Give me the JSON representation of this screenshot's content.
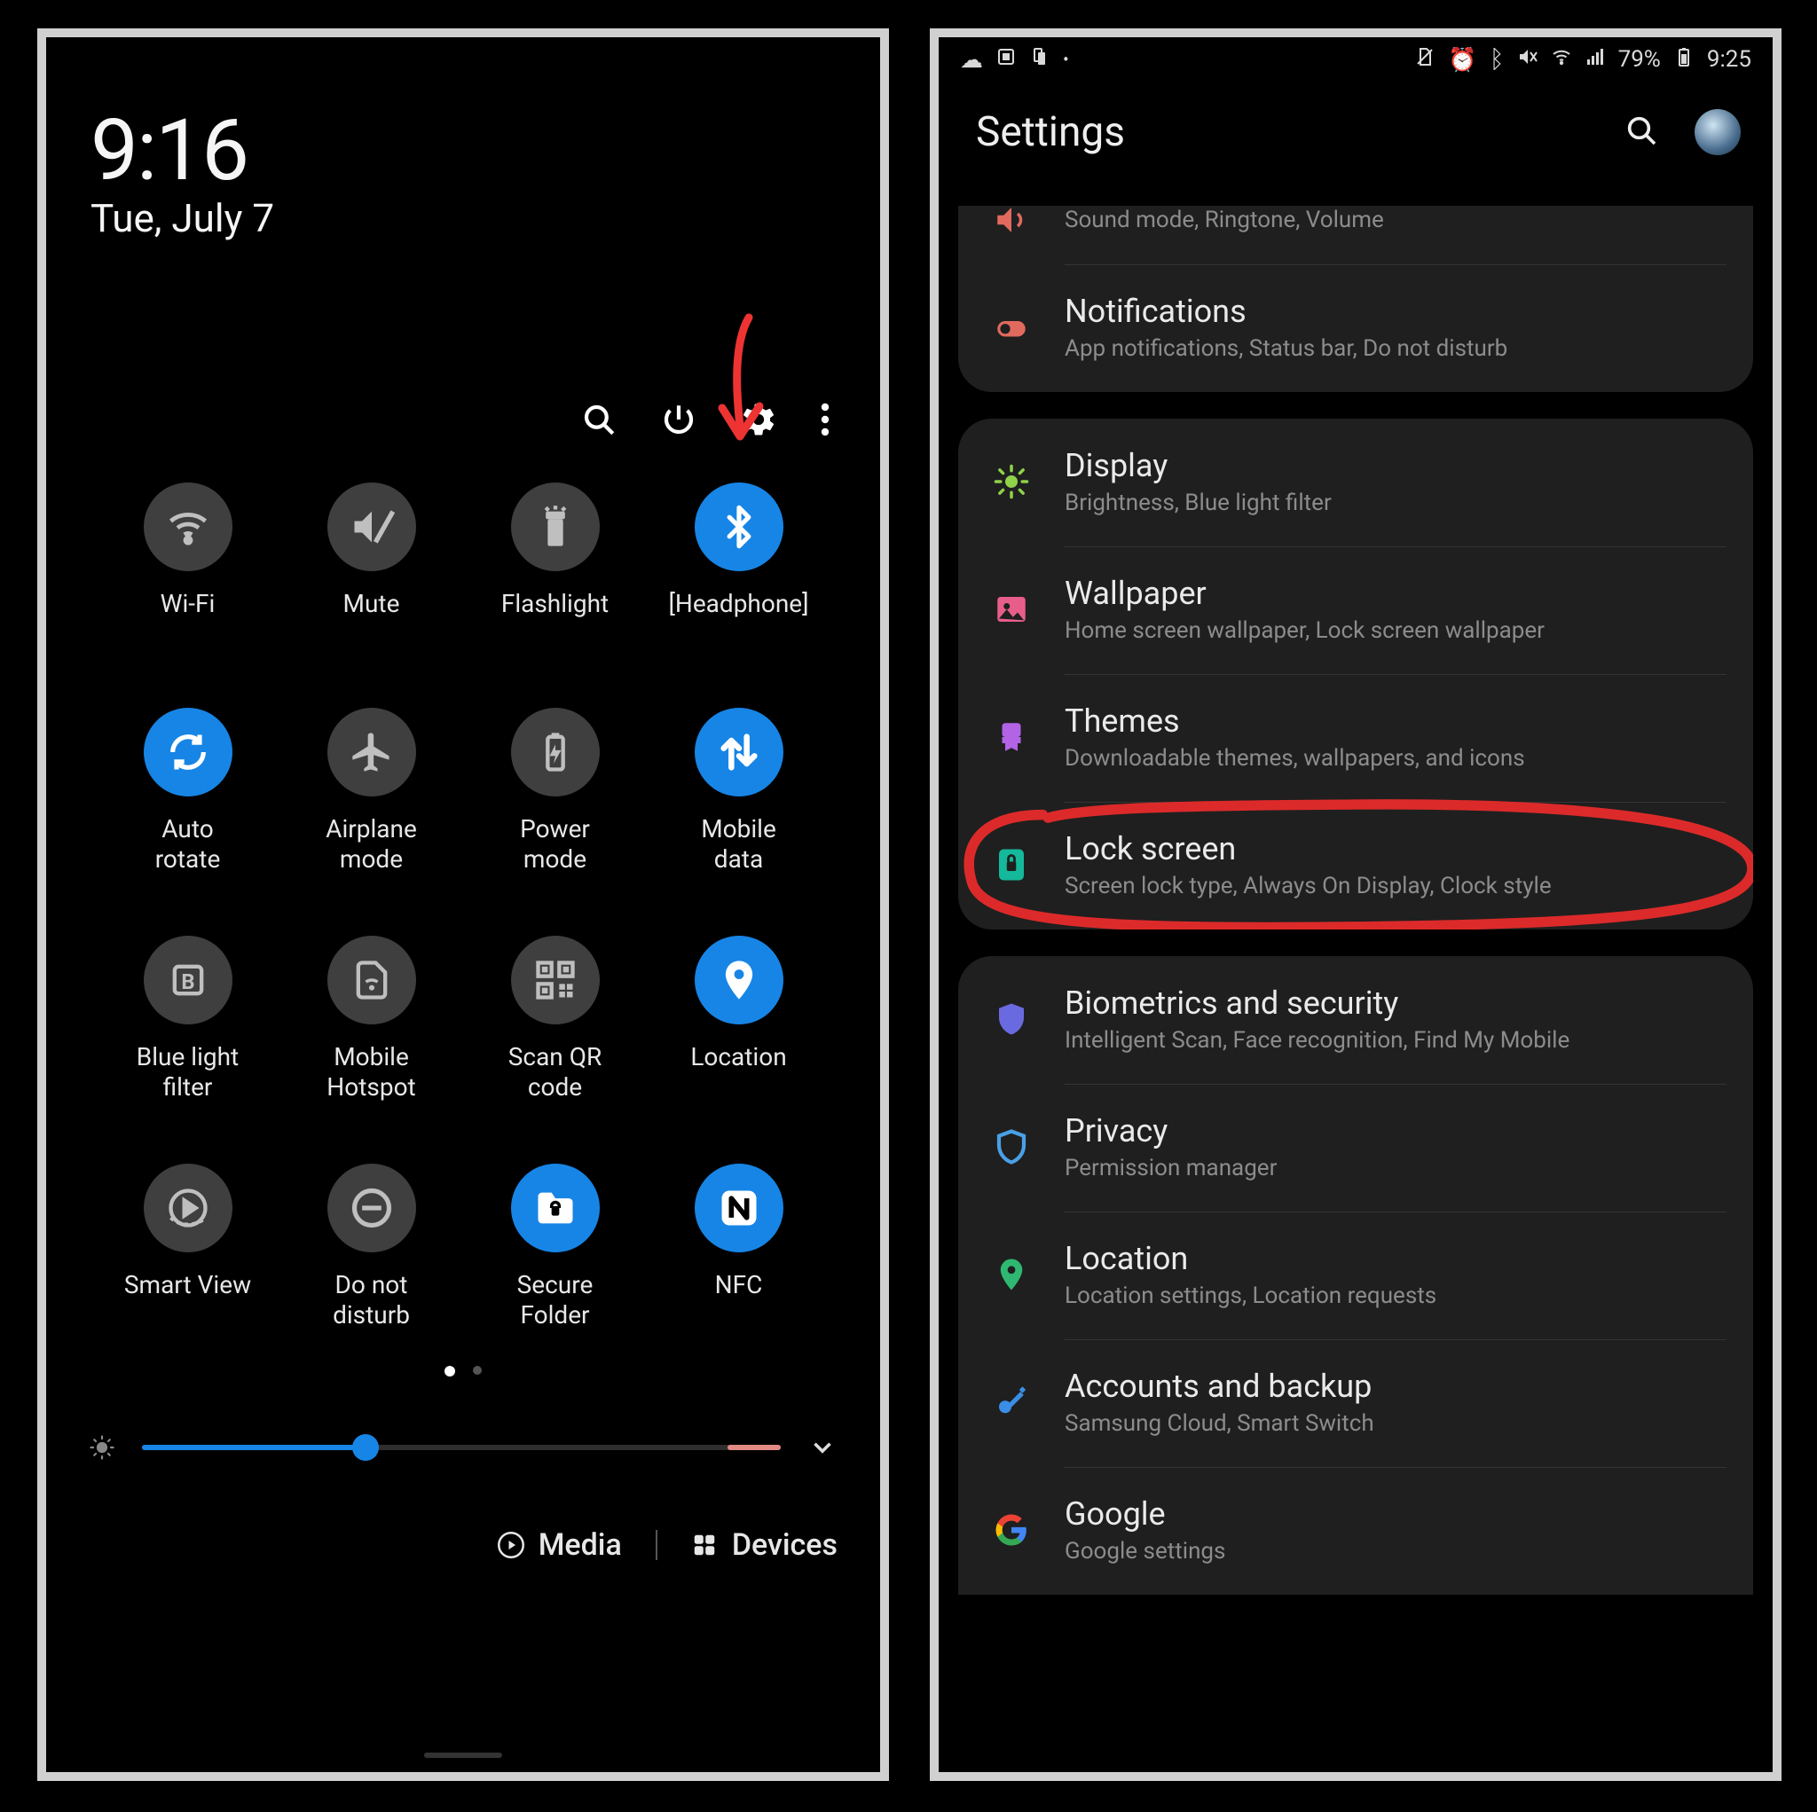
{
  "shot1": {
    "time": "9:16",
    "date": "Tue, July 7",
    "quick_tiles": [
      {
        "icon": "wifi",
        "label": "Wi-Fi",
        "active": false
      },
      {
        "icon": "mute",
        "label": "Mute",
        "active": false
      },
      {
        "icon": "flashlight",
        "label": "Flashlight",
        "active": false
      },
      {
        "icon": "bluetooth",
        "label": "[Headphone]",
        "active": true
      },
      {
        "icon": "rotate",
        "label": "Auto\nrotate",
        "active": true
      },
      {
        "icon": "airplane",
        "label": "Airplane\nmode",
        "active": false
      },
      {
        "icon": "battery",
        "label": "Power\nmode",
        "active": false
      },
      {
        "icon": "data",
        "label": "Mobile\ndata",
        "active": true
      },
      {
        "icon": "bluelight",
        "label": "Blue light\nfilter",
        "active": false
      },
      {
        "icon": "hotspot",
        "label": "Mobile\nHotspot",
        "active": false
      },
      {
        "icon": "qr",
        "label": "Scan QR\ncode",
        "active": false
      },
      {
        "icon": "location",
        "label": "Location",
        "active": true
      },
      {
        "icon": "smartview",
        "label": "Smart View",
        "active": false
      },
      {
        "icon": "dnd",
        "label": "Do not\ndisturb",
        "active": false
      },
      {
        "icon": "folder",
        "label": "Secure\nFolder",
        "active": true
      },
      {
        "icon": "nfc",
        "label": "NFC",
        "active": true
      }
    ],
    "brightness_percent": 35,
    "footer": {
      "media": "Media",
      "devices": "Devices"
    }
  },
  "shot2": {
    "status": {
      "battery": "79%",
      "time": "9:25"
    },
    "title": "Settings",
    "groups": [
      {
        "rows": [
          {
            "ico": "sound",
            "color": "#e06a5e",
            "title": "",
            "sub": "Sound mode, Ringtone, Volume",
            "trunc_top": true
          },
          {
            "ico": "notification",
            "color": "#e06a5e",
            "title": "Notifications",
            "sub": "App notifications, Status bar, Do not disturb"
          }
        ]
      },
      {
        "rows": [
          {
            "ico": "display",
            "color": "#8fd24a",
            "title": "Display",
            "sub": "Brightness, Blue light filter"
          },
          {
            "ico": "wallpaper",
            "color": "#e85e8a",
            "title": "Wallpaper",
            "sub": "Home screen wallpaper, Lock screen wallpaper"
          },
          {
            "ico": "themes",
            "color": "#b263e6",
            "title": "Themes",
            "sub": "Downloadable themes, wallpapers, and icons"
          },
          {
            "ico": "lock",
            "color": "#14b89a",
            "title": "Lock screen",
            "sub": "Screen lock type, Always On Display, Clock style",
            "circled": true
          }
        ]
      },
      {
        "rows": [
          {
            "ico": "shield",
            "color": "#6a6ae0",
            "title": "Biometrics and security",
            "sub": "Intelligent Scan, Face recognition, Find My Mobile"
          },
          {
            "ico": "privacy",
            "color": "#4aa0e6",
            "title": "Privacy",
            "sub": "Permission manager"
          },
          {
            "ico": "pin",
            "color": "#2fb871",
            "title": "Location",
            "sub": "Location settings, Location requests"
          },
          {
            "ico": "key",
            "color": "#3a8ee6",
            "title": "Accounts and backup",
            "sub": "Samsung Cloud, Smart Switch"
          },
          {
            "ico": "google",
            "color": "#4285F4",
            "title": "Google",
            "sub": "Google settings",
            "trunc_bottom": true
          }
        ]
      }
    ]
  }
}
